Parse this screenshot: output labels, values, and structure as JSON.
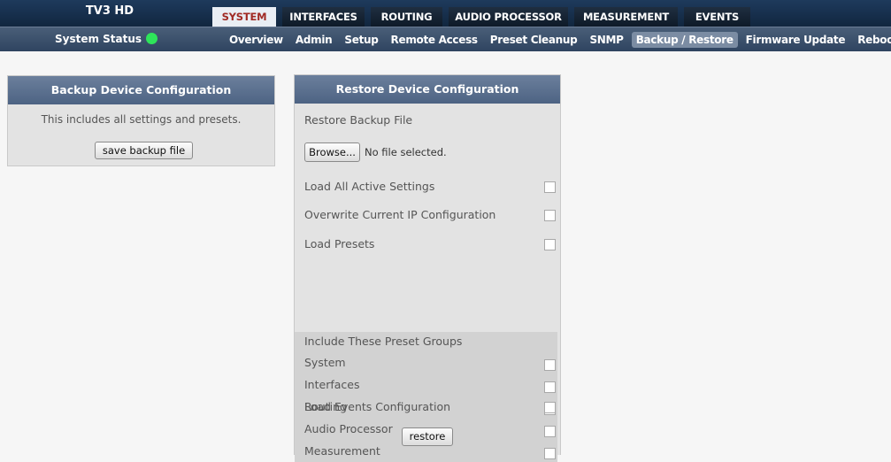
{
  "header": {
    "device_name": "TV3 HD",
    "tabs": [
      {
        "label": "SYSTEM",
        "active": true
      },
      {
        "label": "INTERFACES",
        "active": false
      },
      {
        "label": "ROUTING",
        "active": false
      },
      {
        "label": "AUDIO PROCESSOR",
        "active": false
      },
      {
        "label": "MEASUREMENT",
        "active": false
      },
      {
        "label": "EVENTS",
        "active": false
      }
    ]
  },
  "subheader": {
    "status_label": "System Status",
    "status_color": "#2ee45a",
    "items": [
      {
        "label": "Overview",
        "active": false
      },
      {
        "label": "Admin",
        "active": false
      },
      {
        "label": "Setup",
        "active": false
      },
      {
        "label": "Remote Access",
        "active": false
      },
      {
        "label": "Preset Cleanup",
        "active": false
      },
      {
        "label": "SNMP",
        "active": false
      },
      {
        "label": "Backup / Restore",
        "active": true
      },
      {
        "label": "Firmware Update",
        "active": false
      },
      {
        "label": "Reboot",
        "active": false
      }
    ]
  },
  "backup": {
    "title": "Backup Device Configuration",
    "description": "This includes all settings and presets.",
    "button_label": "save backup file"
  },
  "restore": {
    "title": "Restore Device Configuration",
    "file_label": "Restore Backup File",
    "browse_label": "Browse...",
    "file_status": "No file selected.",
    "options": [
      {
        "label": "Load All Active Settings",
        "checked": false
      },
      {
        "label": "Overwrite Current IP Configuration",
        "checked": false
      },
      {
        "label": "Load Presets",
        "checked": false
      }
    ],
    "group_title": "Include These Preset Groups",
    "groups": [
      {
        "label": "System",
        "checked": false
      },
      {
        "label": "Interfaces",
        "checked": false
      },
      {
        "label": "Routing",
        "checked": false
      },
      {
        "label": "Audio Processor",
        "checked": false
      },
      {
        "label": "Measurement",
        "checked": false
      }
    ],
    "events_label": "Load Events Configuration",
    "events_checked": false,
    "restore_button": "restore"
  }
}
